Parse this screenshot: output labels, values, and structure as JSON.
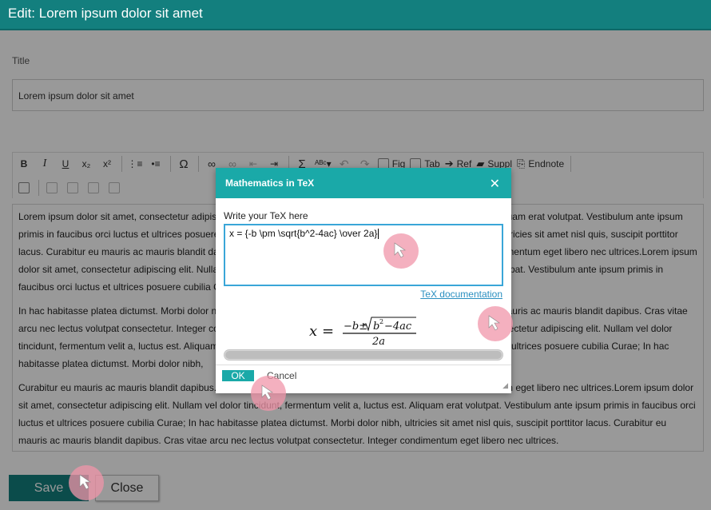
{
  "header": {
    "title": "Edit: Lorem ipsum dolor sit amet"
  },
  "form": {
    "title_label": "Title",
    "title_value": "Lorem ipsum dolor sit amet"
  },
  "toolbar": {
    "buttons": [
      {
        "name": "bold",
        "glyph": "B"
      },
      {
        "name": "italic",
        "glyph": "I"
      },
      {
        "name": "underline",
        "glyph": "U"
      },
      {
        "name": "subscript",
        "glyph": "x₂"
      },
      {
        "name": "superscript",
        "glyph": "x²"
      },
      {
        "name": "ordered-list",
        "glyph": "⋮≡"
      },
      {
        "name": "unordered-list",
        "glyph": "•≡"
      },
      {
        "name": "special-char",
        "glyph": "Ω"
      },
      {
        "name": "link",
        "glyph": "🔗"
      },
      {
        "name": "unlink",
        "glyph": "⛓"
      },
      {
        "name": "outdent",
        "glyph": "⇤"
      },
      {
        "name": "indent",
        "glyph": "⇥"
      },
      {
        "name": "math",
        "glyph": "Σ"
      },
      {
        "name": "spellcheck",
        "glyph": "ᴬᴮᶜ▾"
      },
      {
        "name": "undo",
        "glyph": "↶"
      },
      {
        "name": "redo",
        "glyph": "↷"
      }
    ],
    "fig_label": "Fig",
    "tab_label": "Tab",
    "ref_label": "Ref",
    "suppl_label": "Suppl",
    "endnote_label": "Endnote"
  },
  "editor": {
    "paragraphs": [
      "Lorem ipsum dolor sit amet, consectetur adipiscing elit. Nullam vel dolor tincidunt, fermentum velit a, luctus est. Aliquam erat volutpat. Vestibulum ante ipsum primis in faucibus orci luctus et ultrices posuere cubilia Curae; In hac habitasse platea dictumst. Morbi dolor nibh, ultricies sit amet nisl quis, suscipit porttitor lacus. Curabitur eu mauris ac mauris blandit dapibus. Cras vitae arcu nec lectus volutpat consectetur. Integer condimentum eget libero nec ultrices.Lorem ipsum dolor sit amet, consectetur adipiscing elit. Nullam vel dolor tincidunt, fermentum velit a, luctus est. Aliquam erat volutpat. Vestibulum ante ipsum primis in faucibus orci luctus et ultrices posuere cubilia Curae;",
      "In hac habitasse platea dictumst. Morbi dolor nibh, ultricies sit amet nisl quis, suscipit porttitor lacus. Curabitur eu mauris ac mauris blandit dapibus. Cras vitae arcu nec lectus volutpat consectetur. Integer condimentum eget libero nec ultrices.Lorem ipsum dolor sit amet, consectetur adipiscing elit. Nullam vel dolor tincidunt, fermentum velit a, luctus est. Aliquam erat volutpat. Vestibulum ante ipsum primis in faucibus orci luctus et ultrices posuere cubilia Curae; In hac habitasse platea dictumst. Morbi dolor nibh,",
      "Curabitur eu mauris ac mauris blandit dapibus. Cras vitae arcu nec lectus volutpat consectetur. Integer condimentum eget libero nec ultrices.Lorem ipsum dolor sit amet, consectetur adipiscing elit. Nullam vel dolor tincidunt, fermentum velit a, luctus est. Aliquam erat volutpat. Vestibulum ante ipsum primis in faucibus orci luctus et ultrices posuere cubilia Curae; In hac habitasse platea dictumst. Morbi dolor nibh, ultricies sit amet nisl quis, suscipit porttitor lacus. Curabitur eu mauris ac mauris blandit dapibus. Cras vitae arcu nec lectus volutpat consectetur. Integer condimentum eget libero nec ultrices."
    ]
  },
  "actions": {
    "save_label": "Save",
    "close_label": "Close"
  },
  "dialog": {
    "title": "Mathematics in TeX",
    "close_glyph": "✕",
    "prompt": "Write your TeX here",
    "tex_value": "x = {-b \\pm \\sqrt{b^2-4ac} \\over 2a}",
    "doc_link": "TeX documentation",
    "preview": {
      "lhs": "x",
      "eq": "=",
      "numerator_left": "−b±",
      "radicand": "b",
      "exponent": "2",
      "radicand_rest": "−4ac",
      "denominator": "2a"
    },
    "ok_label": "OK",
    "cancel_label": "Cancel"
  },
  "colors": {
    "header": "#137f7e",
    "dialog_header": "#1aa9a8",
    "link": "#2a8fc0",
    "marker": "#f096aa"
  }
}
